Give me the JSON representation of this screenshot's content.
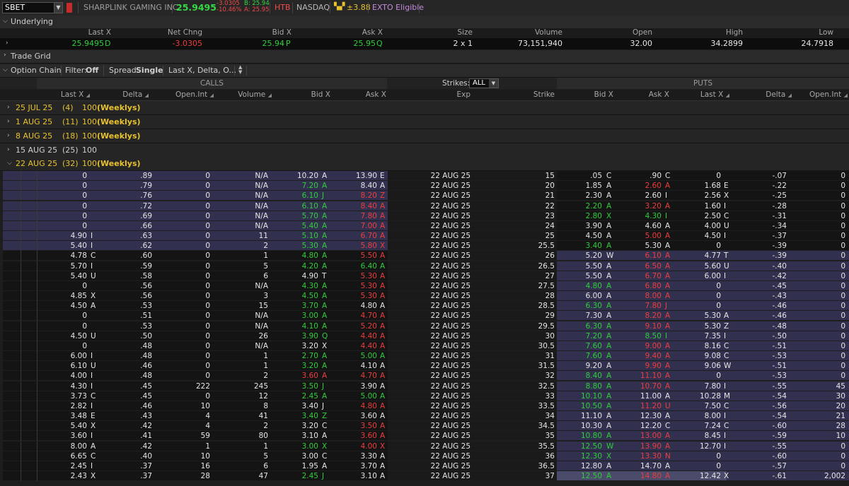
{
  "header": {
    "symbol": "SBET",
    "company": "SHARPLINK GAMING INC",
    "last": "25.9495",
    "net_change": "-3.0305",
    "pct_change": "-10.46%",
    "bid": "B: 25.94",
    "ask": "A: 25.95",
    "htb": "HTB",
    "exchange": "NASDAQ",
    "mm_icon": "market-maker-icon",
    "mm_move": "±3.88",
    "exto": "EXTO Eligible"
  },
  "underlying": {
    "title": "Underlying",
    "columns": [
      "Last X",
      "Net Chng",
      "Bid X",
      "Ask X",
      "Size",
      "Volume",
      "Open",
      "High",
      "Low"
    ],
    "values": {
      "last": "25.9495",
      "last_ex": "D",
      "net_chng": "-3.0305",
      "bid": "25.94",
      "bid_ex": "P",
      "ask": "25.95",
      "ask_ex": "Q",
      "size": "2 x 1",
      "volume": "73,151,940",
      "open": "32.00",
      "high": "34.2899",
      "low": "24.7918"
    }
  },
  "trade_grid": {
    "title": "Trade Grid"
  },
  "option_chain": {
    "title": "Option Chain",
    "filter_label": "Filter:",
    "filter_value": "Off",
    "spread_label": "Spread:",
    "spread_value": "Single",
    "layout_value": "Last X, Delta, O...",
    "calls_label": "CALLS",
    "puts_label": "PUTS",
    "strikes_label": "Strikes:",
    "strikes_value": "ALL",
    "call_columns": [
      "Last X",
      "Delta",
      "Open.Int",
      "Volume",
      "Bid X",
      "Ask X"
    ],
    "mid_columns": [
      "Exp",
      "Strike"
    ],
    "put_columns": [
      "Bid X",
      "Ask X",
      "Last X",
      "Delta",
      "Open.Int"
    ],
    "expirations": [
      {
        "date": "25 JUL 25",
        "days": "(4)",
        "mult": "100",
        "tag": "(Weeklys)",
        "open": false,
        "weekly": true
      },
      {
        "date": "1 AUG 25",
        "days": "(11)",
        "mult": "100",
        "tag": "(Weeklys)",
        "open": false,
        "weekly": true
      },
      {
        "date": "8 AUG 25",
        "days": "(18)",
        "mult": "100",
        "tag": "(Weeklys)",
        "open": false,
        "weekly": true
      },
      {
        "date": "15 AUG 25",
        "days": "(25)",
        "mult": "100",
        "tag": "",
        "open": false,
        "weekly": false
      },
      {
        "date": "22 AUG 25",
        "days": "(32)",
        "mult": "100",
        "tag": "(Weeklys)",
        "open": true,
        "weekly": true
      }
    ],
    "rows": [
      {
        "itm": "call",
        "cl": "0",
        "cle": "",
        "cd": ".89",
        "coi": "0",
        "cv": "N/A",
        "cb": "10.20",
        "cbe": "A",
        "cbc": "w",
        "ca": "13.90",
        "cae": "E",
        "cac": "w",
        "exp": "22 AUG 25",
        "k": "15",
        "pb": ".05",
        "pbe": "C",
        "pbc": "w",
        "pa": ".90",
        "pae": "C",
        "pac": "w",
        "pl": "0",
        "ple": "",
        "pd": "-.07",
        "poi": "0"
      },
      {
        "itm": "call",
        "cl": "0",
        "cle": "",
        "cd": ".79",
        "coi": "0",
        "cv": "N/A",
        "cb": "7.20",
        "cbe": "A",
        "cbc": "g",
        "ca": "8.40",
        "cae": "A",
        "cac": "w",
        "exp": "22 AUG 25",
        "k": "20",
        "pb": "1.85",
        "pbe": "A",
        "pbc": "w",
        "pa": "2.60",
        "pae": "A",
        "pac": "r",
        "pl": "1.68",
        "ple": "E",
        "pd": "-.22",
        "poi": "0"
      },
      {
        "itm": "call",
        "cl": "0",
        "cle": "",
        "cd": ".76",
        "coi": "0",
        "cv": "N/A",
        "cb": "6.10",
        "cbe": "J",
        "cbc": "g",
        "ca": "8.20",
        "cae": "Z",
        "cac": "r",
        "exp": "22 AUG 25",
        "k": "21",
        "pb": "2.30",
        "pbe": "A",
        "pbc": "w",
        "pa": "2.60",
        "pae": "I",
        "pac": "w",
        "pl": "2.56",
        "ple": "X",
        "pd": "-.25",
        "poi": "0"
      },
      {
        "itm": "call",
        "cl": "0",
        "cle": "",
        "cd": ".72",
        "coi": "0",
        "cv": "N/A",
        "cb": "6.10",
        "cbe": "A",
        "cbc": "g",
        "ca": "8.40",
        "cae": "A",
        "cac": "r",
        "exp": "22 AUG 25",
        "k": "22",
        "pb": "2.20",
        "pbe": "A",
        "pbc": "g",
        "pa": "3.20",
        "pae": "A",
        "pac": "r",
        "pl": "1.60",
        "ple": "I",
        "pd": "-.28",
        "poi": "0"
      },
      {
        "itm": "call",
        "cl": "0",
        "cle": "",
        "cd": ".69",
        "coi": "0",
        "cv": "N/A",
        "cb": "5.70",
        "cbe": "A",
        "cbc": "g",
        "ca": "7.80",
        "cae": "A",
        "cac": "r",
        "exp": "22 AUG 25",
        "k": "23",
        "pb": "2.80",
        "pbe": "X",
        "pbc": "g",
        "pa": "4.30",
        "pae": "I",
        "pac": "g",
        "pl": "2.50",
        "ple": "C",
        "pd": "-.31",
        "poi": "0"
      },
      {
        "itm": "call",
        "cl": "0",
        "cle": "",
        "cd": ".66",
        "coi": "0",
        "cv": "N/A",
        "cb": "5.40",
        "cbe": "A",
        "cbc": "g",
        "ca": "7.00",
        "cae": "A",
        "cac": "r",
        "exp": "22 AUG 25",
        "k": "24",
        "pb": "3.90",
        "pbe": "A",
        "pbc": "w",
        "pa": "4.60",
        "pae": "A",
        "pac": "w",
        "pl": "4.00",
        "ple": "U",
        "pd": "-.34",
        "poi": "0"
      },
      {
        "itm": "call",
        "cl": "4.90",
        "cle": "I",
        "cd": ".63",
        "coi": "0",
        "cv": "11",
        "cb": "5.10",
        "cbe": "A",
        "cbc": "g",
        "ca": "6.70",
        "cae": "A",
        "cac": "r",
        "exp": "22 AUG 25",
        "k": "25",
        "pb": "4.50",
        "pbe": "A",
        "pbc": "w",
        "pa": "5.00",
        "pae": "A",
        "pac": "r",
        "pl": "4.50",
        "ple": "I",
        "pd": "-.37",
        "poi": "0"
      },
      {
        "itm": "call",
        "cl": "5.40",
        "cle": "I",
        "cd": ".62",
        "coi": "0",
        "cv": "2",
        "cb": "5.30",
        "cbe": "A",
        "cbc": "g",
        "ca": "5.80",
        "cae": "X",
        "cac": "r",
        "exp": "22 AUG 25",
        "k": "25.5",
        "pb": "3.40",
        "pbe": "A",
        "pbc": "g",
        "pa": "5.30",
        "pae": "A",
        "pac": "w",
        "pl": "0",
        "ple": "",
        "pd": "-.39",
        "poi": "0"
      },
      {
        "itm": "put",
        "cl": "4.78",
        "cle": "C",
        "cd": ".60",
        "coi": "0",
        "cv": "1",
        "cb": "4.80",
        "cbe": "A",
        "cbc": "g",
        "ca": "5.50",
        "cae": "A",
        "cac": "r",
        "exp": "22 AUG 25",
        "k": "26",
        "pb": "5.20",
        "pbe": "W",
        "pbc": "w",
        "pa": "6.10",
        "pae": "A",
        "pac": "r",
        "pl": "4.77",
        "ple": "T",
        "pd": "-.39",
        "poi": "0"
      },
      {
        "itm": "put",
        "cl": "5.70",
        "cle": "I",
        "cd": ".59",
        "coi": "0",
        "cv": "5",
        "cb": "4.20",
        "cbe": "A",
        "cbc": "g",
        "ca": "6.40",
        "cae": "A",
        "cac": "g",
        "exp": "22 AUG 25",
        "k": "26.5",
        "pb": "5.50",
        "pbe": "A",
        "pbc": "w",
        "pa": "6.50",
        "pae": "A",
        "pac": "r",
        "pl": "5.60",
        "ple": "U",
        "pd": "-.40",
        "poi": "0"
      },
      {
        "itm": "put",
        "cl": "5.40",
        "cle": "U",
        "cd": ".58",
        "coi": "0",
        "cv": "6",
        "cb": "4.90",
        "cbe": "T",
        "cbc": "w",
        "ca": "5.30",
        "cae": "A",
        "cac": "r",
        "exp": "22 AUG 25",
        "k": "27",
        "pb": "5.50",
        "pbe": "A",
        "pbc": "w",
        "pa": "6.70",
        "pae": "A",
        "pac": "r",
        "pl": "6.00",
        "ple": "I",
        "pd": "-.42",
        "poi": "0"
      },
      {
        "itm": "put",
        "cl": "0",
        "cle": "",
        "cd": ".56",
        "coi": "0",
        "cv": "N/A",
        "cb": "4.30",
        "cbe": "A",
        "cbc": "g",
        "ca": "5.30",
        "cae": "A",
        "cac": "r",
        "exp": "22 AUG 25",
        "k": "27.5",
        "pb": "4.80",
        "pbe": "A",
        "pbc": "g",
        "pa": "6.80",
        "pae": "A",
        "pac": "r",
        "pl": "0",
        "ple": "",
        "pd": "-.45",
        "poi": "0"
      },
      {
        "itm": "put",
        "cl": "4.85",
        "cle": "X",
        "cd": ".56",
        "coi": "0",
        "cv": "3",
        "cb": "4.50",
        "cbe": "A",
        "cbc": "g",
        "ca": "5.30",
        "cae": "A",
        "cac": "r",
        "exp": "22 AUG 25",
        "k": "28",
        "pb": "6.00",
        "pbe": "A",
        "pbc": "w",
        "pa": "8.00",
        "pae": "A",
        "pac": "r",
        "pl": "0",
        "ple": "",
        "pd": "-.43",
        "poi": "0"
      },
      {
        "itm": "put",
        "cl": "4.50",
        "cle": "A",
        "cd": ".53",
        "coi": "0",
        "cv": "15",
        "cb": "3.70",
        "cbe": "A",
        "cbc": "g",
        "ca": "4.80",
        "cae": "A",
        "cac": "w",
        "exp": "22 AUG 25",
        "k": "28.5",
        "pb": "6.30",
        "pbe": "A",
        "pbc": "g",
        "pa": "7.80",
        "pae": "J",
        "pac": "r",
        "pl": "0",
        "ple": "",
        "pd": "-.46",
        "poi": "0"
      },
      {
        "itm": "put",
        "cl": "0",
        "cle": "",
        "cd": ".51",
        "coi": "0",
        "cv": "N/A",
        "cb": "3.00",
        "cbe": "A",
        "cbc": "g",
        "ca": "4.70",
        "cae": "A",
        "cac": "r",
        "exp": "22 AUG 25",
        "k": "29",
        "pb": "7.30",
        "pbe": "A",
        "pbc": "w",
        "pa": "8.20",
        "pae": "A",
        "pac": "r",
        "pl": "5.30",
        "ple": "A",
        "pd": "-.46",
        "poi": "0"
      },
      {
        "itm": "put",
        "cl": "0",
        "cle": "",
        "cd": ".53",
        "coi": "0",
        "cv": "N/A",
        "cb": "4.10",
        "cbe": "A",
        "cbc": "g",
        "ca": "5.20",
        "cae": "A",
        "cac": "r",
        "exp": "22 AUG 25",
        "k": "29.5",
        "pb": "6.30",
        "pbe": "A",
        "pbc": "g",
        "pa": "9.10",
        "pae": "A",
        "pac": "r",
        "pl": "5.30",
        "ple": "Z",
        "pd": "-.48",
        "poi": "0"
      },
      {
        "itm": "put",
        "cl": "4.50",
        "cle": "U",
        "cd": ".50",
        "coi": "0",
        "cv": "26",
        "cb": "3.90",
        "cbe": "Q",
        "cbc": "g",
        "ca": "4.40",
        "cae": "A",
        "cac": "r",
        "exp": "22 AUG 25",
        "k": "30",
        "pb": "7.20",
        "pbe": "A",
        "pbc": "g",
        "pa": "8.50",
        "pae": "I",
        "pac": "g",
        "pl": "7.35",
        "ple": "I",
        "pd": "-.50",
        "poi": "0"
      },
      {
        "itm": "put",
        "cl": "0",
        "cle": "",
        "cd": ".48",
        "coi": "0",
        "cv": "N/A",
        "cb": "3.20",
        "cbe": "X",
        "cbc": "w",
        "ca": "4.40",
        "cae": "A",
        "cac": "r",
        "exp": "22 AUG 25",
        "k": "30.5",
        "pb": "7.60",
        "pbe": "A",
        "pbc": "g",
        "pa": "9.00",
        "pae": "A",
        "pac": "r",
        "pl": "8.16",
        "ple": "C",
        "pd": "-.51",
        "poi": "0"
      },
      {
        "itm": "put",
        "cl": "6.00",
        "cle": "I",
        "cd": ".48",
        "coi": "0",
        "cv": "1",
        "cb": "2.70",
        "cbe": "A",
        "cbc": "g",
        "ca": "5.00",
        "cae": "A",
        "cac": "g",
        "exp": "22 AUG 25",
        "k": "31",
        "pb": "7.60",
        "pbe": "A",
        "pbc": "g",
        "pa": "9.40",
        "pae": "A",
        "pac": "r",
        "pl": "9.08",
        "ple": "C",
        "pd": "-.53",
        "poi": "0"
      },
      {
        "itm": "put",
        "cl": "6.10",
        "cle": "U",
        "cd": ".46",
        "coi": "0",
        "cv": "1",
        "cb": "3.20",
        "cbe": "A",
        "cbc": "g",
        "ca": "4.10",
        "cae": "A",
        "cac": "w",
        "exp": "22 AUG 25",
        "k": "31.5",
        "pb": "9.20",
        "pbe": "A",
        "pbc": "w",
        "pa": "9.90",
        "pae": "A",
        "pac": "r",
        "pl": "9.06",
        "ple": "W",
        "pd": "-.51",
        "poi": "0"
      },
      {
        "itm": "put",
        "cl": "4.00",
        "cle": "I",
        "cd": ".48",
        "coi": "0",
        "cv": "2",
        "cb": "3.60",
        "cbe": "A",
        "cbc": "r",
        "ca": "4.70",
        "cae": "A",
        "cac": "r",
        "exp": "22 AUG 25",
        "k": "32",
        "pb": "8.40",
        "pbe": "A",
        "pbc": "g",
        "pa": "11.10",
        "pae": "A",
        "pac": "r",
        "pl": "0",
        "ple": "",
        "pd": "-.53",
        "poi": "0"
      },
      {
        "itm": "put",
        "cl": "4.30",
        "cle": "I",
        "cd": ".45",
        "coi": "222",
        "cv": "245",
        "cb": "3.50",
        "cbe": "J",
        "cbc": "g",
        "ca": "3.90",
        "cae": "A",
        "cac": "w",
        "exp": "22 AUG 25",
        "k": "32.5",
        "pb": "8.80",
        "pbe": "A",
        "pbc": "g",
        "pa": "10.70",
        "pae": "A",
        "pac": "r",
        "pl": "7.80",
        "ple": "I",
        "pd": "-.55",
        "poi": "45"
      },
      {
        "itm": "put",
        "cl": "3.73",
        "cle": "C",
        "cd": ".45",
        "coi": "0",
        "cv": "12",
        "cb": "2.45",
        "cbe": "A",
        "cbc": "g",
        "ca": "5.00",
        "cae": "A",
        "cac": "g",
        "exp": "22 AUG 25",
        "k": "33",
        "pb": "10.10",
        "pbe": "A",
        "pbc": "g",
        "pa": "11.00",
        "pae": "A",
        "pac": "w",
        "pl": "10.28",
        "ple": "M",
        "pd": "-.54",
        "poi": "30"
      },
      {
        "itm": "put",
        "cl": "2.82",
        "cle": "I",
        "cd": ".46",
        "coi": "10",
        "cv": "8",
        "cb": "3.40",
        "cbe": "J",
        "cbc": "w",
        "ca": "4.80",
        "cae": "A",
        "cac": "r",
        "exp": "22 AUG 25",
        "k": "33.5",
        "pb": "10.50",
        "pbe": "A",
        "pbc": "g",
        "pa": "11.20",
        "pae": "U",
        "pac": "r",
        "pl": "7.50",
        "ple": "C",
        "pd": "-.56",
        "poi": "20"
      },
      {
        "itm": "put",
        "cl": "3.48",
        "cle": "E",
        "cd": ".43",
        "coi": "4",
        "cv": "41",
        "cb": "3.40",
        "cbe": "Z",
        "cbc": "g",
        "ca": "3.60",
        "cae": "A",
        "cac": "w",
        "exp": "22 AUG 25",
        "k": "34",
        "pb": "11.10",
        "pbe": "A",
        "pbc": "w",
        "pa": "12.30",
        "pae": "A",
        "pac": "w",
        "pl": "8.00",
        "ple": "I",
        "pd": "-.54",
        "poi": "21"
      },
      {
        "itm": "put",
        "cl": "5.40",
        "cle": "X",
        "cd": ".42",
        "coi": "4",
        "cv": "2",
        "cb": "3.20",
        "cbe": "C",
        "cbc": "w",
        "ca": "3.50",
        "cae": "A",
        "cac": "r",
        "exp": "22 AUG 25",
        "k": "34.5",
        "pb": "10.30",
        "pbe": "A",
        "pbc": "w",
        "pa": "12.20",
        "pae": "C",
        "pac": "w",
        "pl": "7.24",
        "ple": "C",
        "pd": "-.60",
        "poi": "28"
      },
      {
        "itm": "put",
        "cl": "3.60",
        "cle": "I",
        "cd": ".41",
        "coi": "59",
        "cv": "80",
        "cb": "3.10",
        "cbe": "A",
        "cbc": "w",
        "ca": "3.60",
        "cae": "A",
        "cac": "r",
        "exp": "22 AUG 25",
        "k": "35",
        "pb": "10.80",
        "pbe": "A",
        "pbc": "g",
        "pa": "13.00",
        "pae": "A",
        "pac": "r",
        "pl": "8.45",
        "ple": "I",
        "pd": "-.59",
        "poi": "10"
      },
      {
        "itm": "put",
        "cl": "8.00",
        "cle": "A",
        "cd": ".42",
        "coi": "1",
        "cv": "1",
        "cb": "3.00",
        "cbe": "X",
        "cbc": "g",
        "ca": "4.00",
        "cae": "X",
        "cac": "r",
        "exp": "22 AUG 25",
        "k": "35.5",
        "pb": "12.50",
        "pbe": "W",
        "pbc": "g",
        "pa": "13.90",
        "pae": "A",
        "pac": "r",
        "pl": "12.70",
        "ple": "I",
        "pd": "-.55",
        "poi": "0"
      },
      {
        "itm": "put",
        "cl": "6.65",
        "cle": "C",
        "cd": ".40",
        "coi": "10",
        "cv": "5",
        "cb": "3.00",
        "cbe": "C",
        "cbc": "w",
        "ca": "3.30",
        "cae": "A",
        "cac": "w",
        "exp": "22 AUG 25",
        "k": "36",
        "pb": "12.30",
        "pbe": "X",
        "pbc": "g",
        "pa": "13.30",
        "pae": "N",
        "pac": "r",
        "pl": "0",
        "ple": "",
        "pd": "-.60",
        "poi": "0"
      },
      {
        "itm": "put",
        "cl": "2.45",
        "cle": "I",
        "cd": ".37",
        "coi": "16",
        "cv": "6",
        "cb": "1.95",
        "cbe": "A",
        "cbc": "w",
        "ca": "3.70",
        "cae": "A",
        "cac": "w",
        "exp": "22 AUG 25",
        "k": "36.5",
        "pb": "12.80",
        "pbe": "A",
        "pbc": "w",
        "pa": "14.70",
        "pae": "A",
        "pac": "w",
        "pl": "0",
        "ple": "",
        "pd": "-.57",
        "poi": "0"
      },
      {
        "itm": "put",
        "cl": "2.43",
        "cle": "X",
        "cd": ".37",
        "coi": "28",
        "cv": "47",
        "cb": "2.45",
        "cbe": "J",
        "cbc": "g",
        "ca": "3.10",
        "cae": "A",
        "cac": "w",
        "exp": "22 AUG 25",
        "k": "37",
        "pb": "12.50",
        "pbe": "A",
        "pbc": "g",
        "pa": "14.80",
        "pae": "A",
        "pac": "r",
        "pl": "12.42",
        "ple": "X",
        "pd": "-.61",
        "poi": "2,002",
        "sel": true
      }
    ]
  },
  "colors": {
    "itm_call_bg": "#31314f",
    "itm_put_bg": "#31314f",
    "dark_row_bg": "#141414",
    "up": "#2fcf3a",
    "down": "#ef3d3d",
    "weekly": "#e8c22e",
    "exto": "#c38bde"
  }
}
